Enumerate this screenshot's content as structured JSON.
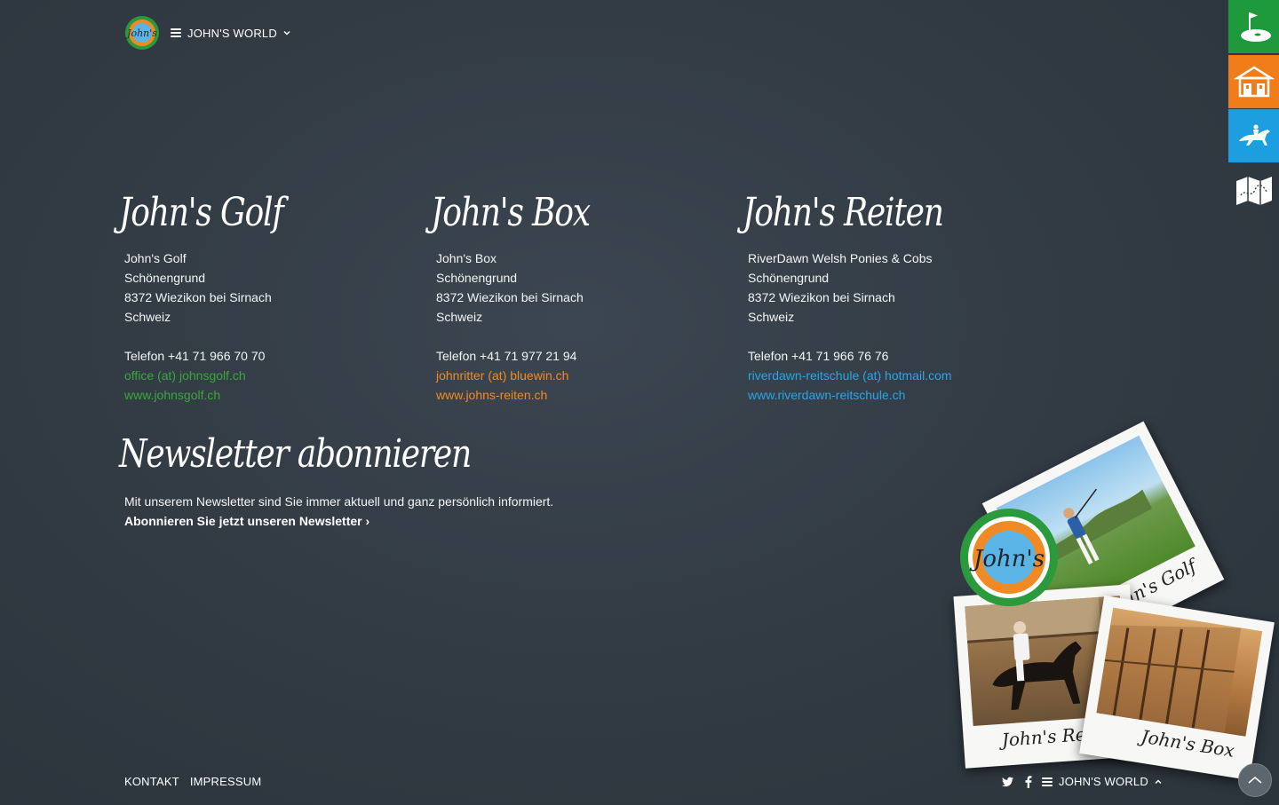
{
  "header": {
    "logo_text": "John's",
    "menu_label": "JOHN'S WORLD"
  },
  "side_tabs": [
    {
      "name": "golf-icon",
      "color": "#1e9a3c"
    },
    {
      "name": "stable-icon",
      "color": "#f07d1a"
    },
    {
      "name": "horse-rider-icon",
      "color": "#1d9ee0"
    },
    {
      "name": "map-icon",
      "color": "transparent"
    }
  ],
  "colors": {
    "golf": "#3aa63c",
    "box": "#f08a24",
    "reiten": "#2aa5e6"
  },
  "sections": {
    "golf": {
      "heading": "John's Golf",
      "name": "John's Golf",
      "street": "Schönengrund",
      "city": "8372 Wiezikon bei Sirnach",
      "country": "Schweiz",
      "phone": "Telefon +41 71 966 70 70",
      "email": "office (at) johnsgolf.ch",
      "web": "www.johnsgolf.ch"
    },
    "box": {
      "heading": "John's Box",
      "name": "John's Box",
      "street": "Schönengrund",
      "city": "8372 Wiezikon bei Sirnach",
      "country": "Schweiz",
      "phone": "Telefon +41 71 977 21 94",
      "email": "johnritter (at) bluewin.ch",
      "web": "www.johns-reiten.ch"
    },
    "reiten": {
      "heading": "John's Reiten",
      "name": "RiverDawn Welsh Ponies & Cobs",
      "street": "Schönengrund",
      "city": "8372 Wiezikon bei Sirnach",
      "country": "Schweiz",
      "phone": "Telefon +41 71 966 76 76",
      "email": "riverdawn-reitschule (at) hotmail.com",
      "web": "www.riverdawn-reitschule.ch"
    }
  },
  "newsletter": {
    "heading": "Newsletter abonnieren",
    "text": "Mit unserem Newsletter sind Sie immer aktuell und ganz persönlich informiert.",
    "link": "Abonnieren Sie jetzt unseren Newsletter ›"
  },
  "collage": {
    "logo_text": "John's",
    "golf_caption": "John's Golf",
    "reiten_caption": "John's Reiten",
    "box_caption": "John's Box"
  },
  "footer": {
    "kontakt": "KONTAKT",
    "impressum": "IMPRESSUM",
    "menu_label": "JOHN'S WORLD",
    "social_icons": [
      "twitter-icon",
      "facebook-icon"
    ]
  }
}
